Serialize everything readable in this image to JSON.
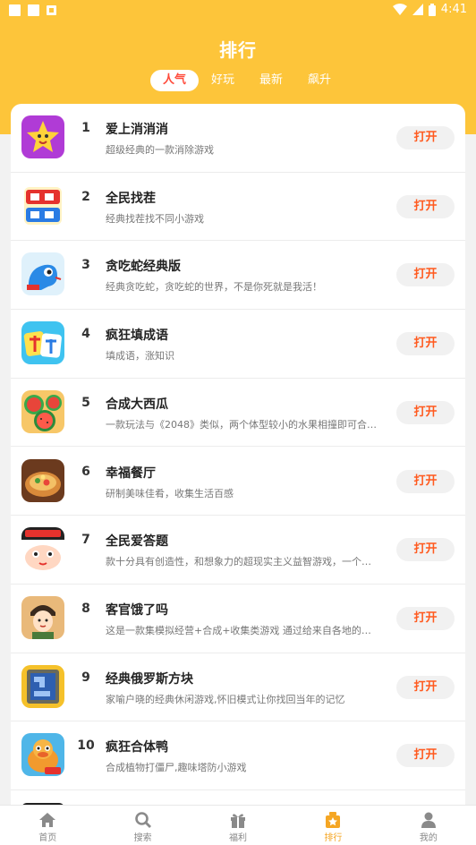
{
  "status_bar": {
    "time": "4:41",
    "icons": [
      "wifi-icon",
      "signal-icon",
      "battery-icon"
    ]
  },
  "header": {
    "title": "排行",
    "tabs": [
      {
        "label": "人气",
        "active": true
      },
      {
        "label": "好玩",
        "active": false
      },
      {
        "label": "最新",
        "active": false
      },
      {
        "label": "飙升",
        "active": false
      }
    ]
  },
  "games": [
    {
      "rank": "1",
      "name": "爱上消消消",
      "desc": "超级经典的一款消除游戏",
      "button": "打开",
      "icon": "star-match-icon"
    },
    {
      "rank": "2",
      "name": "全民找茬",
      "desc": "经典找茬找不同小游戏",
      "button": "打开",
      "icon": "find-difference-icon"
    },
    {
      "rank": "3",
      "name": "贪吃蛇经典版",
      "desc": "经典贪吃蛇，贪吃蛇的世界，不是你死就是我活！",
      "button": "打开",
      "icon": "snake-icon"
    },
    {
      "rank": "4",
      "name": "疯狂填成语",
      "desc": "填成语，涨知识",
      "button": "打开",
      "icon": "idiom-icon"
    },
    {
      "rank": "5",
      "name": "合成大西瓜",
      "desc": "一款玩法与《2048》类似，两个体型较小的水果相撞即可合…",
      "button": "打开",
      "icon": "watermelon-icon"
    },
    {
      "rank": "6",
      "name": "幸福餐厅",
      "desc": "研制美味佳肴，收集生活百感",
      "button": "打开",
      "icon": "restaurant-icon"
    },
    {
      "rank": "7",
      "name": "全民爱答题",
      "desc": "款十分具有创造性，和想象力的超现实主义益智游戏，一个…",
      "button": "打开",
      "icon": "quiz-icon"
    },
    {
      "rank": "8",
      "name": "客官饿了吗",
      "desc": "这是一款集模拟经营+合成+收集类游戏 通过给来自各地的…",
      "button": "打开",
      "icon": "chef-icon"
    },
    {
      "rank": "9",
      "name": "经典俄罗斯方块",
      "desc": "家喻户晓的经典休闲游戏,怀旧模式让你找回当年的记忆",
      "button": "打开",
      "icon": "tetris-icon"
    },
    {
      "rank": "10",
      "name": "疯狂合体鸭",
      "desc": "合成植物打僵尸,趣味塔防小游戏",
      "button": "打开",
      "icon": "duck-icon"
    }
  ],
  "bottom_nav": [
    {
      "label": "首页",
      "icon": "home-icon",
      "active": false
    },
    {
      "label": "搜索",
      "icon": "search-icon",
      "active": false
    },
    {
      "label": "福利",
      "icon": "gift-icon",
      "active": false
    },
    {
      "label": "排行",
      "icon": "ranking-icon",
      "active": true
    },
    {
      "label": "我的",
      "icon": "profile-icon",
      "active": false
    }
  ],
  "colors": {
    "header": "#fdc53a",
    "active_tab_text": "#ff4a3a",
    "button_text": "#ff5a1f",
    "nav_active": "#f5a623"
  }
}
